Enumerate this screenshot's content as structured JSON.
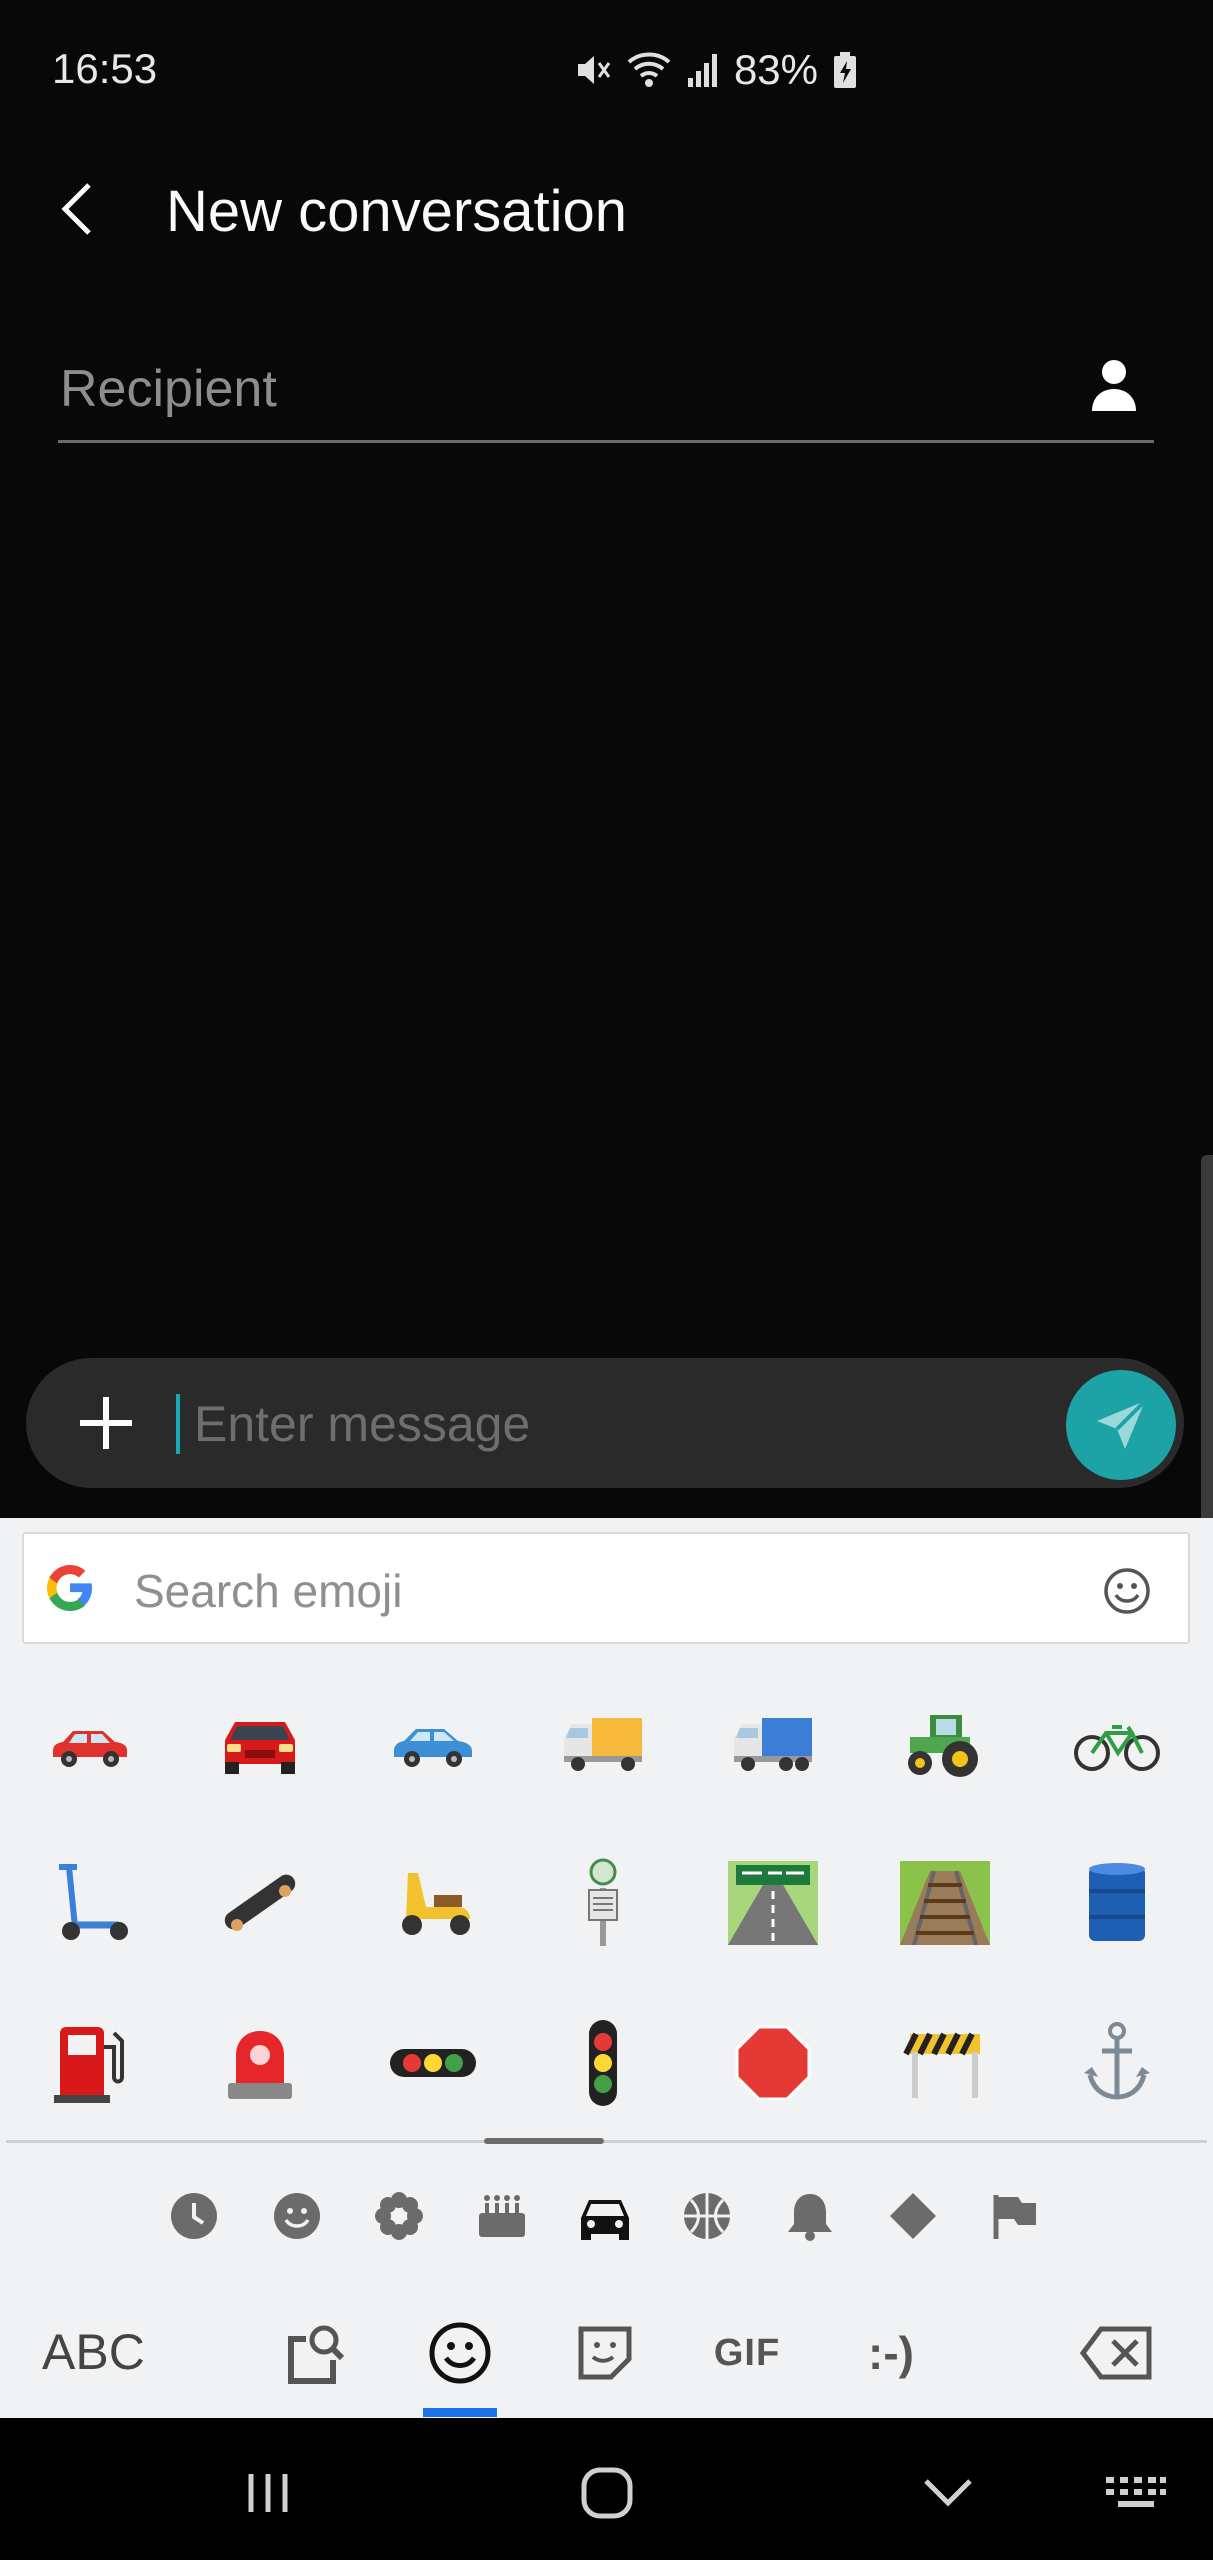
{
  "status_bar": {
    "time": "16:53",
    "battery": "83%",
    "icons": [
      "mute-icon",
      "wifi-icon",
      "signal-icon",
      "battery-charging-icon"
    ]
  },
  "header": {
    "title": "New conversation",
    "back_icon": "back-arrow-icon"
  },
  "recipient": {
    "placeholder": "Recipient",
    "contact_icon": "person-icon"
  },
  "composer": {
    "placeholder": "Enter message",
    "value": "",
    "accent": "#1da3a6"
  },
  "keyboard": {
    "search_placeholder": "Search emoji",
    "active_category": "travel-places",
    "emoji_rows": [
      [
        "red-car",
        "red-sedan",
        "blue-car",
        "delivery-truck",
        "articulated-lorry",
        "tractor",
        "bicycle"
      ],
      [
        "kick-scooter",
        "skateboard",
        "motor-scooter",
        "bus-stop",
        "motorway",
        "railway-track",
        "oil-drum"
      ],
      [
        "fuel-pump",
        "police-car-light",
        "horizontal-traffic-light",
        "vertical-traffic-light",
        "stop-sign",
        "construction",
        "anchor"
      ]
    ],
    "categories": [
      "recent",
      "smileys",
      "nature",
      "food",
      "travel",
      "activities",
      "objects",
      "symbols",
      "flags"
    ],
    "bottom_keys": {
      "abc": "ABC",
      "gif": "GIF",
      "emoticon": ":-)"
    },
    "accent": "#1a73e8"
  },
  "nav_bar": {
    "buttons": [
      "recents",
      "home",
      "back",
      "keyboard"
    ]
  }
}
